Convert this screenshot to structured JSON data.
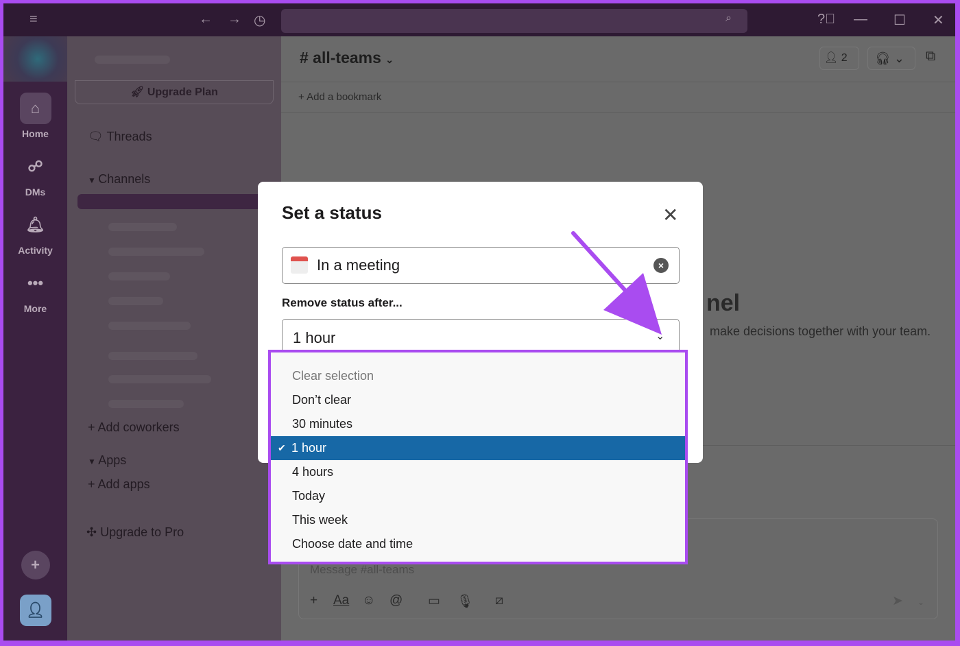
{
  "titlebar": {
    "icons": [
      "menu-icon",
      "back-icon",
      "forward-icon",
      "history-icon",
      "search-icon",
      "help-icon",
      "minimize-icon",
      "maximize-icon",
      "close-icon"
    ]
  },
  "rail": {
    "items": [
      {
        "label": "Home",
        "icon": "home-icon"
      },
      {
        "label": "DMs",
        "icon": "dms-icon"
      },
      {
        "label": "Activity",
        "icon": "bell-icon"
      },
      {
        "label": "More",
        "icon": "more-icon"
      }
    ]
  },
  "sidebar": {
    "upgrade_plan": "Upgrade Plan",
    "threads": "Threads",
    "channels": "Channels",
    "add_coworkers": "Add coworkers",
    "apps": "Apps",
    "add_apps": "Add apps",
    "upgrade_pro": "Upgrade to Pro"
  },
  "main": {
    "channel": "# all-teams",
    "member_count": "2",
    "add_bookmark": "Add a bookmark",
    "hero_fragment": "nel",
    "hero_sub": "make decisions together with your team.",
    "composer_placeholder": "Message #all-teams"
  },
  "modal": {
    "title": "Set a status",
    "status_value": "In a meeting",
    "remove_label": "Remove status after...",
    "selected": "1 hour",
    "options": [
      "Clear selection",
      "Don’t clear",
      "30 minutes",
      "1 hour",
      "4 hours",
      "Today",
      "This week",
      "Choose date and time"
    ]
  },
  "colors": {
    "accent": "#a94cf0",
    "selected": "#1768a6"
  }
}
